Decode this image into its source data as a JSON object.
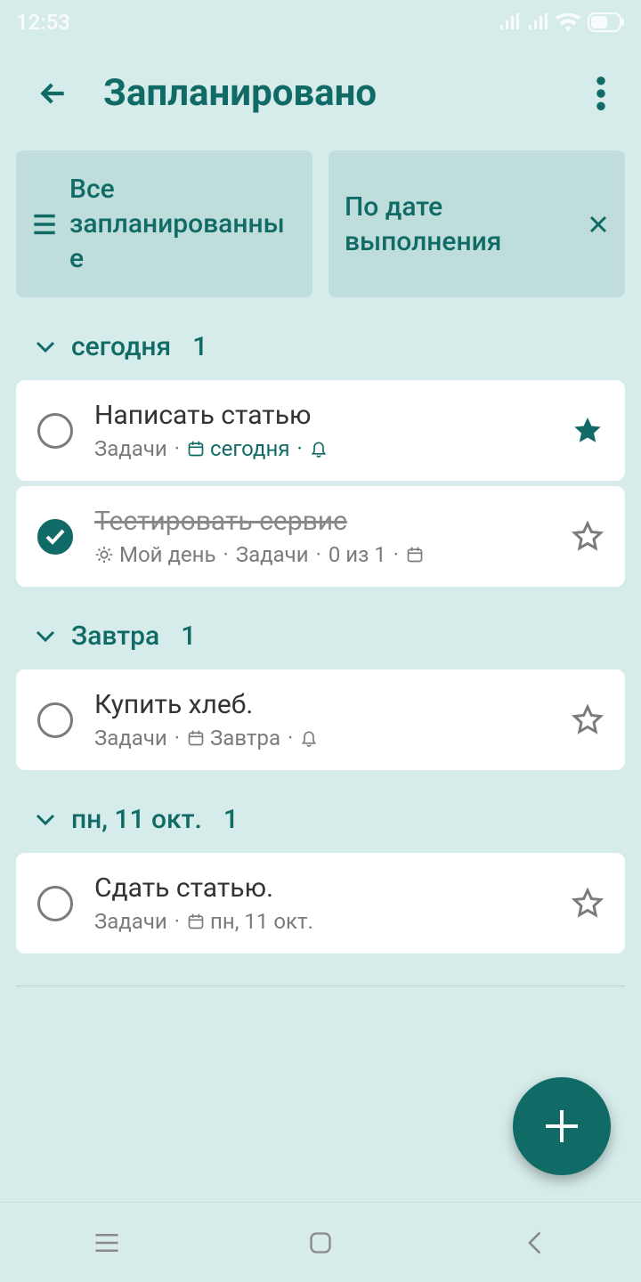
{
  "status": {
    "time": "12:53"
  },
  "header": {
    "title": "Запланировано"
  },
  "filters": {
    "all_label": "Все запланированные",
    "sort_label": "По дате выполнения"
  },
  "sections": [
    {
      "label": "сегодня",
      "count": "1",
      "tasks": [
        {
          "title": "Написать статью",
          "list": "Задачи",
          "due": "сегодня",
          "has_reminder": true,
          "starred": true,
          "done": false
        },
        {
          "title": "Тестировать сервис",
          "myday_label": "Мой день",
          "list": "Задачи",
          "progress": "0 из 1",
          "done": true,
          "starred": false
        }
      ]
    },
    {
      "label": "Завтра",
      "count": "1",
      "tasks": [
        {
          "title": "Купить хлеб.",
          "list": "Задачи",
          "due": "Завтра",
          "has_reminder": true,
          "starred": false,
          "done": false
        }
      ]
    },
    {
      "label": "пн, 11 окт.",
      "count": "1",
      "tasks": [
        {
          "title": "Сдать статью.",
          "list": "Задачи",
          "due": "пн, 11 окт.",
          "starred": false,
          "done": false
        }
      ]
    }
  ]
}
